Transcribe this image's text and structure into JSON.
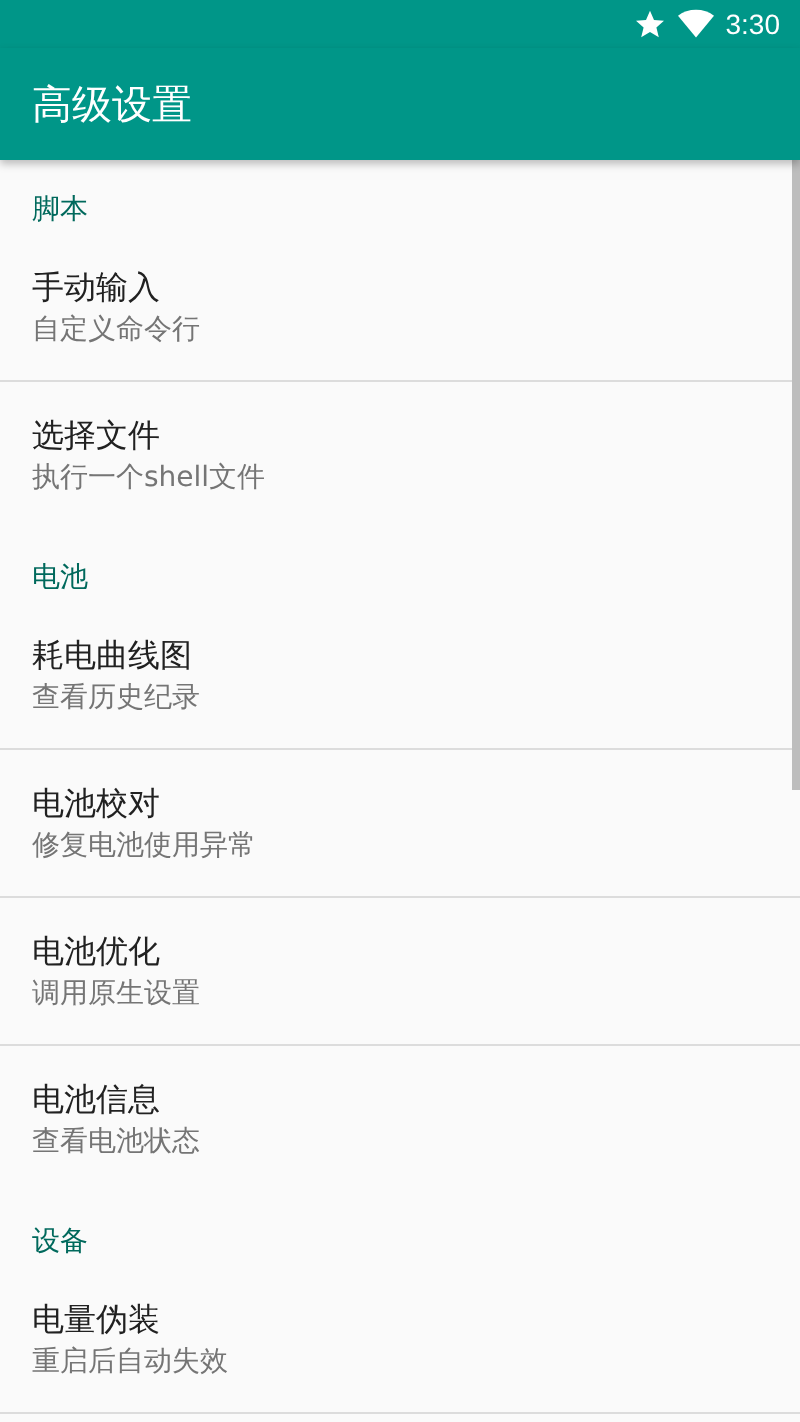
{
  "status_bar": {
    "time": "3:30"
  },
  "app_bar": {
    "title": "高级设置"
  },
  "sections": [
    {
      "header": "脚本",
      "items": [
        {
          "title": "手动输入",
          "summary": "自定义命令行"
        },
        {
          "title": "选择文件",
          "summary": "执行一个shell文件"
        }
      ]
    },
    {
      "header": "电池",
      "items": [
        {
          "title": "耗电曲线图",
          "summary": "查看历史纪录"
        },
        {
          "title": "电池校对",
          "summary": "修复电池使用异常"
        },
        {
          "title": "电池优化",
          "summary": "调用原生设置"
        },
        {
          "title": "电池信息",
          "summary": "查看电池状态"
        }
      ]
    },
    {
      "header": "设备",
      "items": [
        {
          "title": "电量伪装",
          "summary": "重启后自动失效"
        }
      ]
    }
  ]
}
